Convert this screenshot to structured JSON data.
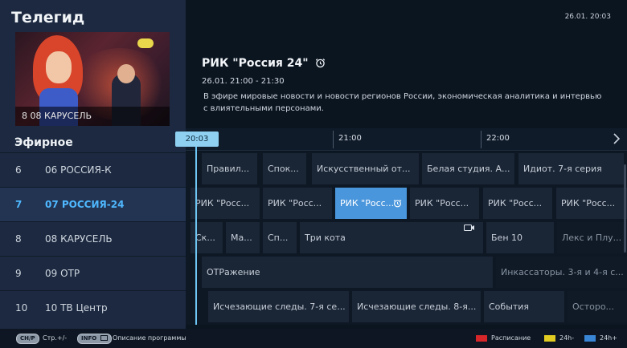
{
  "app": {
    "title": "Телегид",
    "clock": "26.01. 20:03"
  },
  "preview": {
    "caption": "8 08 КАРУСЕЛЬ"
  },
  "program": {
    "title": "РИК \"Россия 24\"",
    "time": "26.01. 21:00 - 21:30",
    "description": "В эфире мировые новости и новости регионов России, экономическая аналитика и интервью с влиятельными персонами."
  },
  "section_label": "Эфирное",
  "timeline": {
    "now": "20:03",
    "ticks": [
      "21:00",
      "22:00"
    ]
  },
  "channels": [
    {
      "num": "6",
      "name": "06 РОССИЯ-К"
    },
    {
      "num": "7",
      "name": "07 РОССИЯ-24"
    },
    {
      "num": "8",
      "name": "08 КАРУСЕЛЬ"
    },
    {
      "num": "9",
      "name": "09 OTP"
    },
    {
      "num": "10",
      "name": "10 ТВ Центр"
    }
  ],
  "schedule": [
    [
      "Правил...",
      "Спок...",
      "Искусственный от...",
      "Белая студия. А...",
      "Идиот. 7-я серия"
    ],
    [
      "РИК \"Росс...",
      "РИК \"Росс...",
      "РИК \"Росс...",
      "РИК \"Росс...",
      "РИК \"Росс...",
      "РИК \"Росс..."
    ],
    [
      "Ск...",
      "Ма...",
      "Сп...",
      "Три кота",
      "Бен 10",
      "Лекс и Плу..."
    ],
    [
      "ОТРажение",
      "Инкассаторы. 3-я и 4-я с..."
    ],
    [
      "Исчезающие следы. 7-я се...",
      "Исчезающие следы. 8-я...",
      "События",
      "Осторо..."
    ]
  ],
  "footer": {
    "ch_key": "CH/P",
    "ch_label": "Стр.+/-",
    "info_key": "INFO",
    "info_label": "Описание программы",
    "legend": [
      {
        "label": "Расписание",
        "color": "#d6262a"
      },
      {
        "label": "24h-",
        "color": "#e2cc21"
      },
      {
        "label": "24h+",
        "color": "#3a86d6"
      }
    ]
  }
}
